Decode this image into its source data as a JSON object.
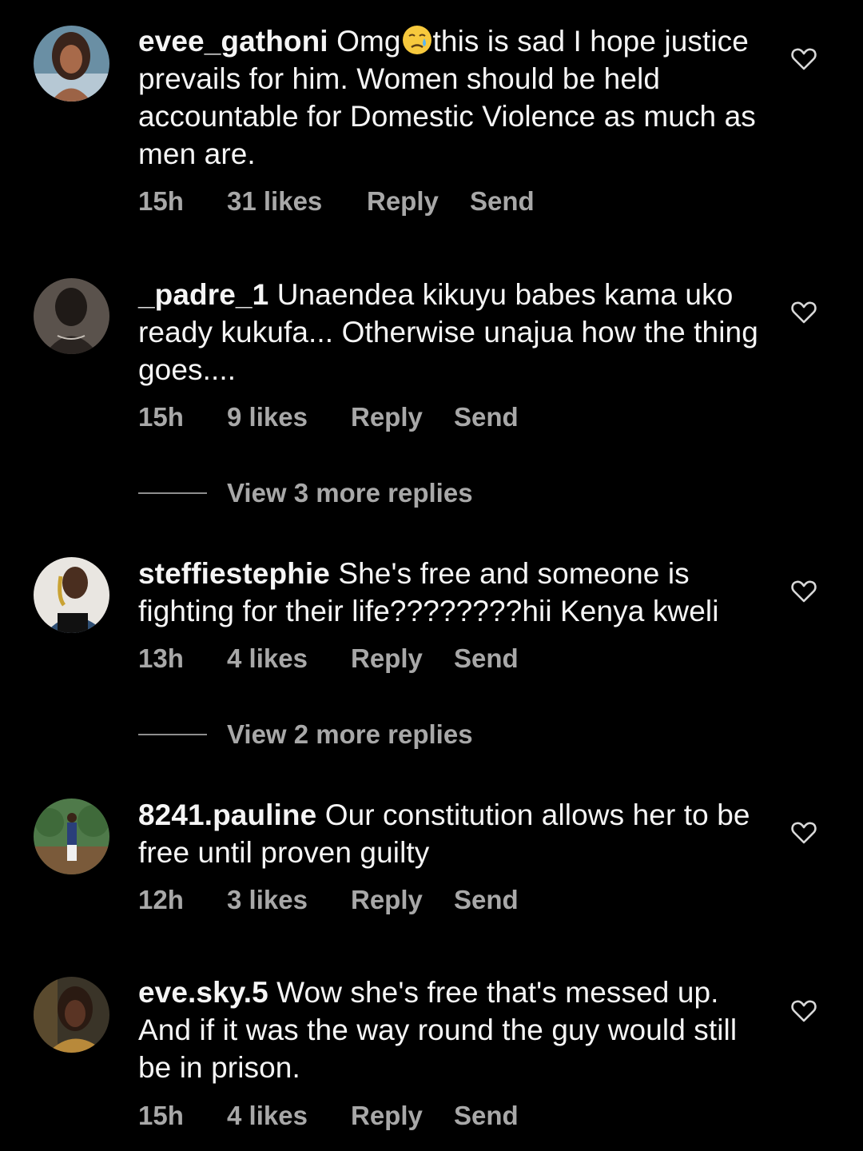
{
  "comments": [
    {
      "username": "evee_gathoni",
      "text_before_emoji": "Omg",
      "emoji": "crying-face",
      "text_after_emoji": "this is sad I hope justice prevails for him. Women should be held accountable for Domestic Violence as much as men are.",
      "time": "15h",
      "likes": "31 likes",
      "reply": "Reply",
      "send": "Send"
    },
    {
      "username": "_padre_1",
      "text": "Unaendea kikuyu babes kama uko ready kukufa... Otherwise unajua how the thing goes....",
      "time": "15h",
      "likes": "9 likes",
      "reply": "Reply",
      "send": "Send",
      "view_replies": "View 3 more replies"
    },
    {
      "username": "steffiestephie",
      "text": "She's free and someone is fighting for their life????????hii Kenya kweli",
      "time": "13h",
      "likes": "4 likes",
      "reply": "Reply",
      "send": "Send",
      "view_replies": "View 2 more replies"
    },
    {
      "username": "8241.pauline",
      "text": "Our constitution allows her to be free until proven guilty",
      "time": "12h",
      "likes": "3 likes",
      "reply": "Reply",
      "send": "Send"
    },
    {
      "username": "eve.sky.5",
      "text": "Wow she's free that's messed up. And if it was the way round the guy would still be in prison.",
      "time": "15h",
      "likes": "4 likes",
      "reply": "Reply",
      "send": "Send"
    }
  ],
  "icons": {
    "like": "heart-outline-icon"
  },
  "colors": {
    "background": "#000000",
    "primary_text": "#f5f5f5",
    "secondary_text": "#a8a8a8"
  }
}
